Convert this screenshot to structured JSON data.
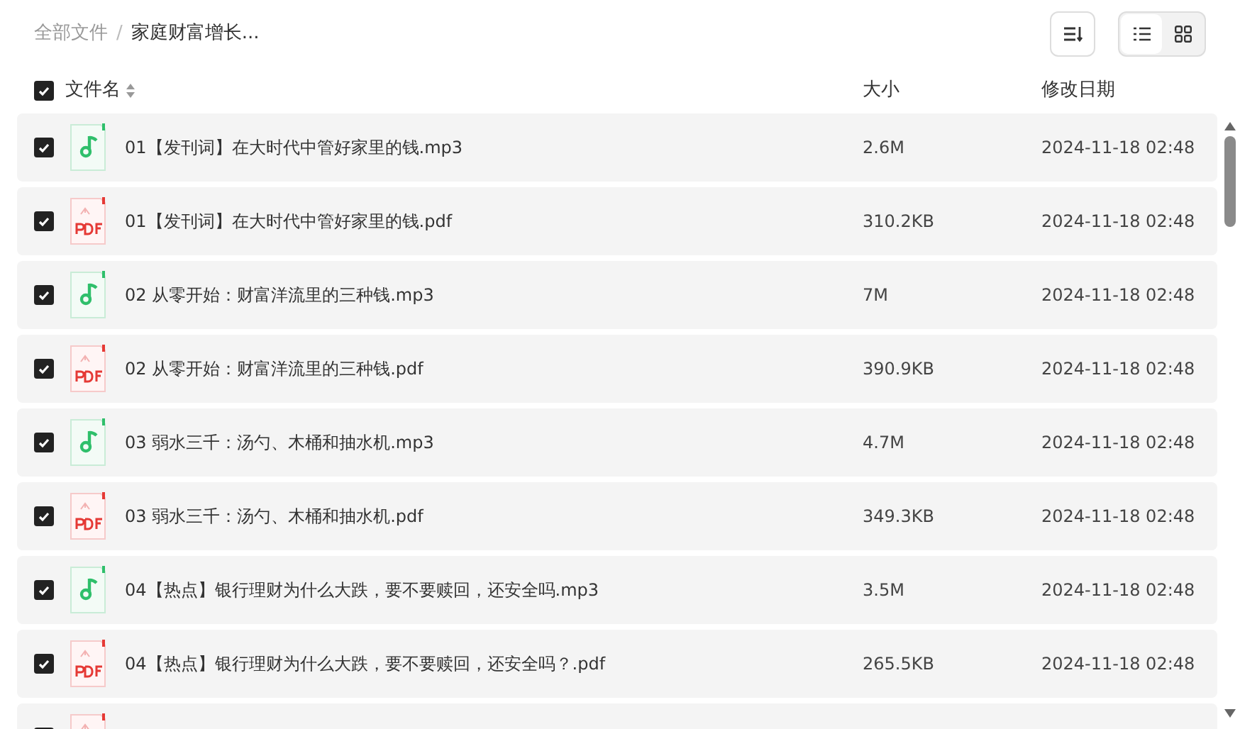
{
  "breadcrumb": [
    {
      "label": "全部文件",
      "current": false
    },
    {
      "separator": "/"
    },
    {
      "label": "家庭财富增长...",
      "current": true
    }
  ],
  "toolbar": {
    "view_modes": [
      {
        "kind": "list",
        "selected": true
      },
      {
        "kind": "grid",
        "selected": false
      }
    ]
  },
  "header": {
    "checked": true,
    "columns": [
      "文件名",
      "大小",
      "修改日期"
    ]
  },
  "files": [
    {
      "kind": "audio",
      "checked": true,
      "name": "01【发刊词】在大时代中管好家里的钱.mp3",
      "size": "2.6M",
      "date": "2024-11-18 02:48"
    },
    {
      "kind": "pdf",
      "checked": true,
      "name": "01【发刊词】在大时代中管好家里的钱.pdf",
      "size": "310.2KB",
      "date": "2024-11-18 02:48"
    },
    {
      "kind": "audio",
      "checked": true,
      "name": "02 从零开始：财富洋流里的三种钱.mp3",
      "size": "7M",
      "date": "2024-11-18 02:48"
    },
    {
      "kind": "pdf",
      "checked": true,
      "name": "02 从零开始：财富洋流里的三种钱.pdf",
      "size": "390.9KB",
      "date": "2024-11-18 02:48"
    },
    {
      "kind": "audio",
      "checked": true,
      "name": "03 弱水三千：汤勺、木桶和抽水机.mp3",
      "size": "4.7M",
      "date": "2024-11-18 02:48"
    },
    {
      "kind": "pdf",
      "checked": true,
      "name": "03 弱水三千：汤勺、木桶和抽水机.pdf",
      "size": "349.3KB",
      "date": "2024-11-18 02:48"
    },
    {
      "kind": "audio",
      "checked": true,
      "name": "04【热点】银行理财为什么大跌，要不要赎回，还安全吗.mp3",
      "size": "3.5M",
      "date": "2024-11-18 02:48"
    },
    {
      "kind": "pdf",
      "checked": true,
      "name": "04【热点】银行理财为什么大跌，要不要赎回，还安全吗？.pdf",
      "size": "265.5KB",
      "date": "2024-11-18 02:48"
    },
    {
      "kind": "pdf",
      "checked": true
    }
  ]
}
